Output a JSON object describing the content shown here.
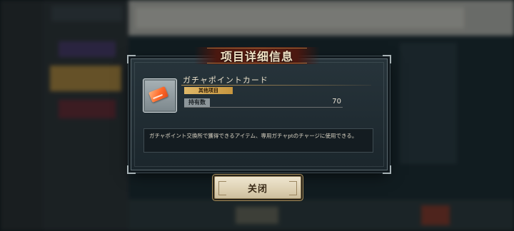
{
  "dialog": {
    "title": "项目详细信息",
    "item": {
      "name": "ガチャポイントカード",
      "icon": "gacha-point-card-icon",
      "category": "其他项目",
      "held_label": "持有数",
      "held_value": "70"
    },
    "description": "ガチャポイント交換所で獲得できるアイテム、専用ガチャptのチャージに使用できる。",
    "close_label": "关闭"
  },
  "colors": {
    "title_banner": "#5a1e13",
    "category_badge": "#d4a857",
    "card_accent": "#ff6a2a"
  }
}
